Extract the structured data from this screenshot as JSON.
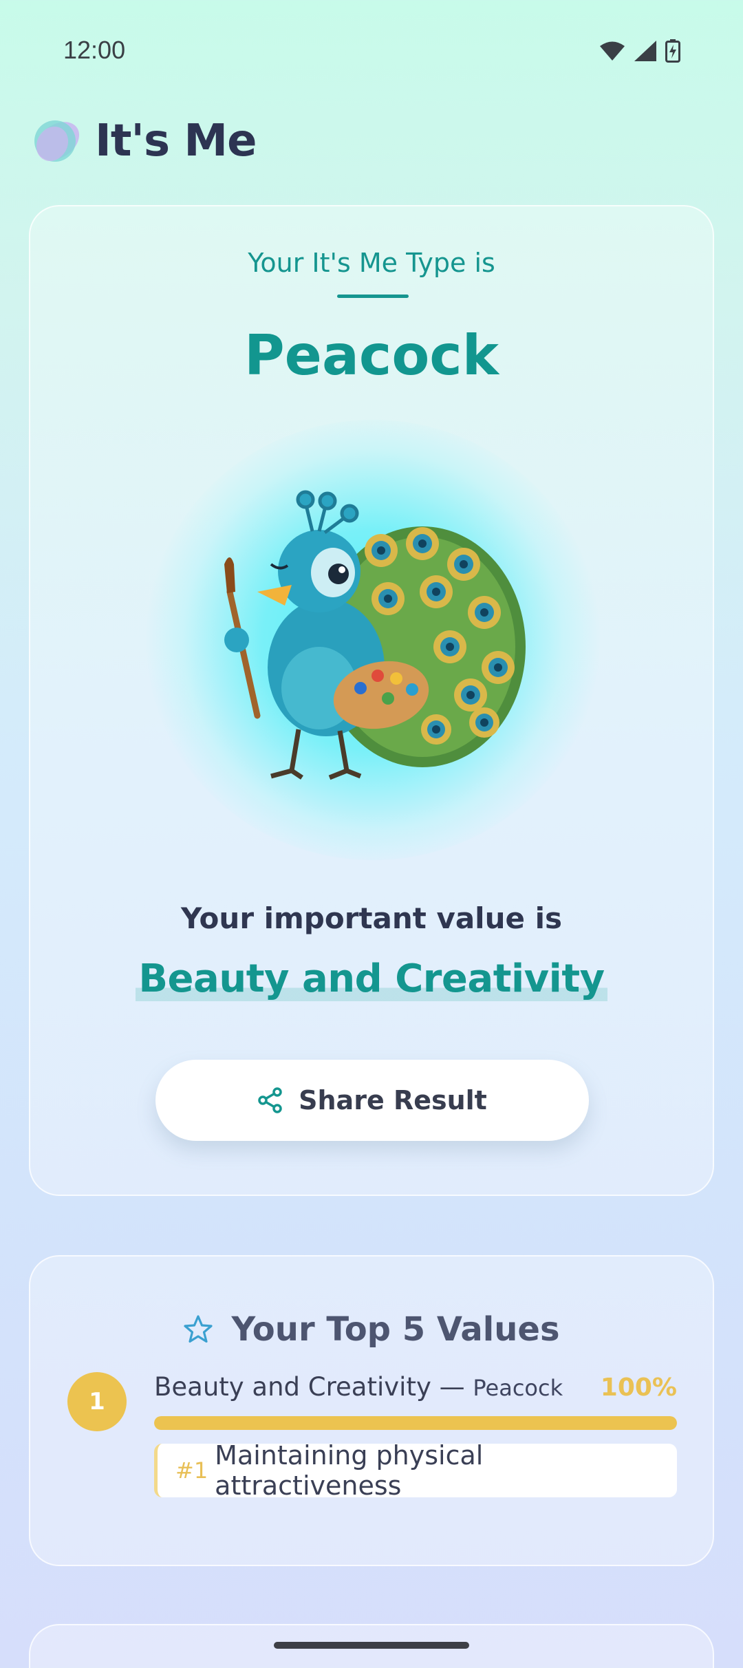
{
  "status_bar": {
    "time": "12:00"
  },
  "app": {
    "title": "It's Me"
  },
  "result": {
    "type_label": "Your It's Me Type is",
    "type_name": "Peacock",
    "value_label": "Your important value is",
    "value_name": "Beauty and Creativity",
    "share_label": "Share Result"
  },
  "top_values": {
    "title": "Your Top 5 Values",
    "items": [
      {
        "rank": "1",
        "title": "Beauty and Creativity —",
        "animal": "Peacock",
        "percent": "100%",
        "progress": 1.0,
        "detail_num": "#1",
        "detail_text": "Maintaining physical attractiveness"
      }
    ]
  },
  "colors": {
    "accent": "#12968f",
    "gold": "#ecc350",
    "text": "#2f3650"
  }
}
